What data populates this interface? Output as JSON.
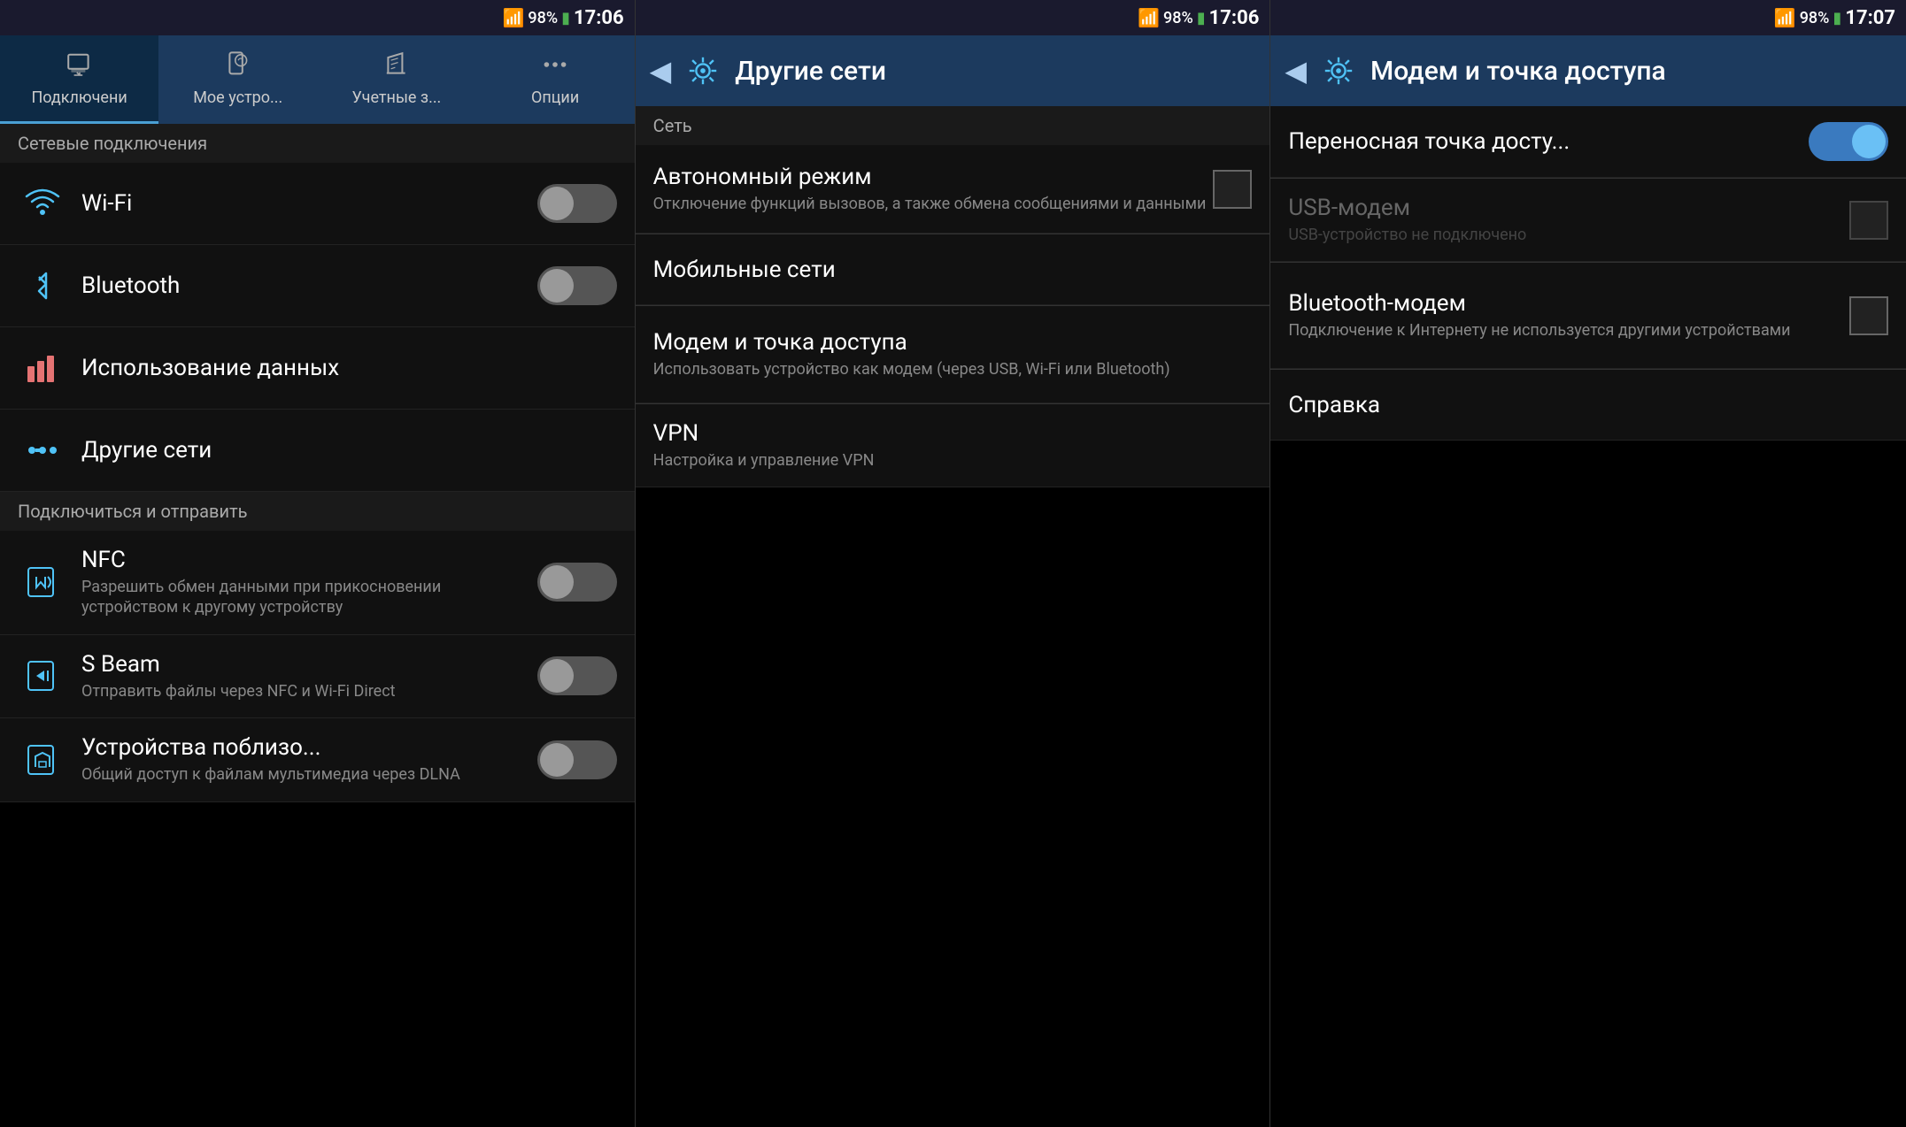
{
  "panels": [
    {
      "id": "panel1",
      "statusBar": {
        "signal": "▲▲▲▲",
        "battery": "98%",
        "batteryIcon": "🔋",
        "time": "17:06"
      },
      "tabs": [
        {
          "id": "connections",
          "icon": "📶",
          "label": "Подключени",
          "active": true
        },
        {
          "id": "mydevice",
          "icon": "📱",
          "label": "Мое устро...",
          "active": false
        },
        {
          "id": "accounts",
          "icon": "✏️",
          "label": "Учетные з...",
          "active": false
        },
        {
          "id": "options",
          "icon": "⋯",
          "label": "Опции",
          "active": false
        }
      ],
      "sections": [
        {
          "header": "Сетевые подключения",
          "items": [
            {
              "icon": "wifi",
              "title": "Wi-Fi",
              "subtitle": "",
              "toggle": true,
              "toggleState": "off"
            },
            {
              "icon": "bluetooth",
              "title": "Bluetooth",
              "subtitle": "",
              "toggle": true,
              "toggleState": "off"
            },
            {
              "icon": "datausage",
              "title": "Использование данных",
              "subtitle": "",
              "toggle": false
            },
            {
              "icon": "othernets",
              "title": "Другие сети",
              "subtitle": "",
              "toggle": false
            }
          ]
        },
        {
          "header": "Подключиться и отправить",
          "items": [
            {
              "icon": "nfc",
              "title": "NFC",
              "subtitle": "Разрешить обмен данными при прикосновении устройством к другому устройству",
              "toggle": true,
              "toggleState": "off"
            },
            {
              "icon": "sbeam",
              "title": "S Beam",
              "subtitle": "Отправить файлы через NFC и Wi-Fi Direct",
              "toggle": true,
              "toggleState": "off"
            },
            {
              "icon": "nearby",
              "title": "Устройства поблизо...",
              "subtitle": "Общий доступ к файлам мультимедиа через DLNA",
              "toggle": true,
              "toggleState": "off"
            }
          ]
        }
      ]
    },
    {
      "id": "panel2",
      "statusBar": {
        "signal": "▲▲▲▲",
        "battery": "98%",
        "time": "17:06"
      },
      "header": {
        "backLabel": "◀",
        "gearIcon": true,
        "title": "Другие сети"
      },
      "sections": [
        {
          "header": "Сеть",
          "items": [
            {
              "title": "Автономный режим",
              "subtitle": "Отключение функций вызовов, а также обмена сообщениями и данными",
              "checkbox": true
            },
            {
              "title": "Мобильные сети",
              "subtitle": "",
              "checkbox": false
            },
            {
              "title": "Модем и точка доступа",
              "subtitle": "Использовать устройство как модем (через USB, Wi-Fi или Bluetooth)",
              "checkbox": false
            },
            {
              "title": "VPN",
              "subtitle": "Настройка и управление VPN",
              "checkbox": false
            }
          ]
        }
      ]
    },
    {
      "id": "panel3",
      "statusBar": {
        "signal": "▲▲▲▲",
        "battery": "98%",
        "time": "17:07"
      },
      "header": {
        "backLabel": "◀",
        "gearIcon": true,
        "title": "Модем и точка доступа"
      },
      "sections": [
        {
          "header": "",
          "items": [
            {
              "title": "Переносная точка досту...",
              "subtitle": "",
              "toggleOn": true
            },
            {
              "title": "USB-модем",
              "subtitle": "USB-устройство не подключено",
              "checkbox": true,
              "disabled": true
            },
            {
              "title": "Bluetooth-модем",
              "subtitle": "Подключение к Интернету не используется другими устройствами",
              "checkbox": true,
              "disabled": false
            },
            {
              "title": "Справка",
              "subtitle": "",
              "checkbox": false
            }
          ]
        }
      ]
    }
  ]
}
